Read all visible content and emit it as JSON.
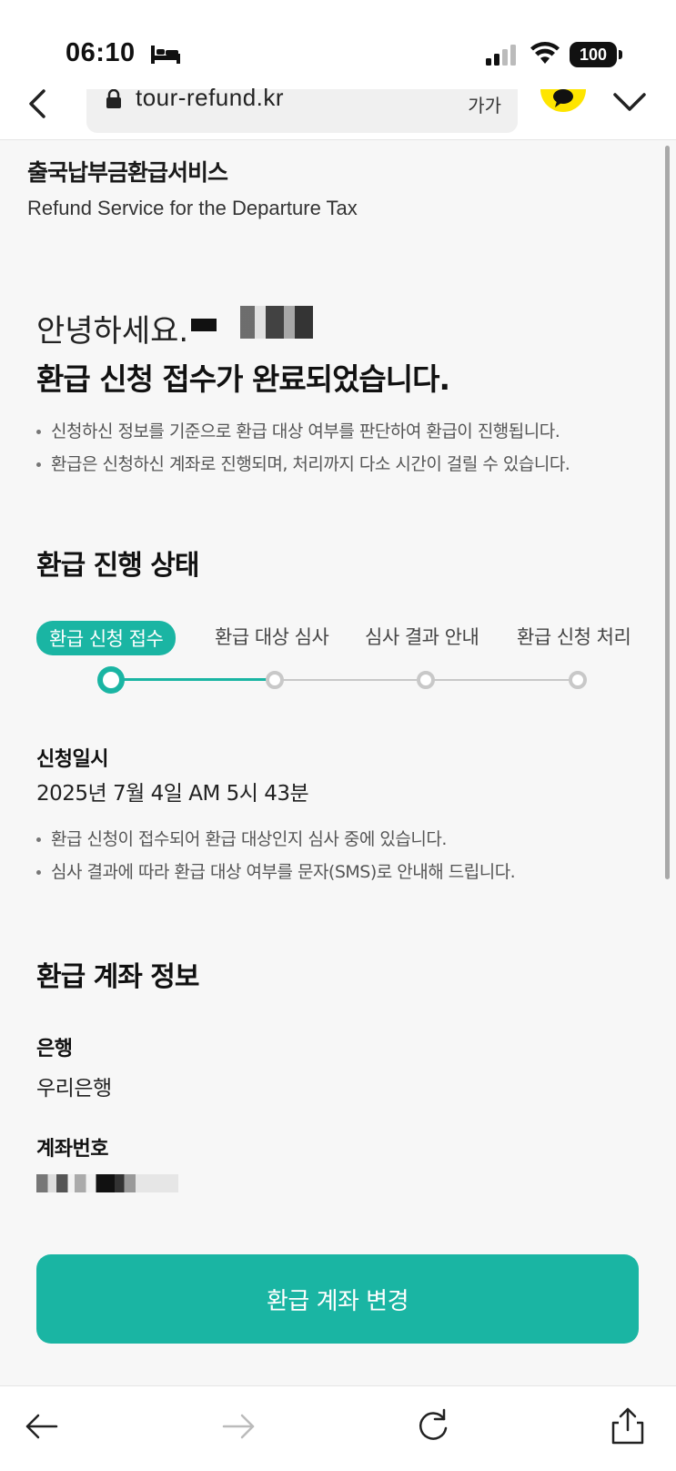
{
  "status_bar": {
    "time": "06:10",
    "battery": "100"
  },
  "browser": {
    "url": "tour-refund.kr",
    "text_size_label": "가가"
  },
  "brand": {
    "name_ko": "출국납부금환급서비스",
    "name_en": "Refund Service for the Departure Tax"
  },
  "greeting": {
    "hello": "안녕하세요.",
    "headline": "환급 신청 접수가 완료되었습니다."
  },
  "intro_notes": [
    "신청하신 정보를 기준으로 환급 대상 여부를 판단하여 환급이 진행됩니다.",
    "환급은 신청하신 계좌로 진행되며, 처리까지 다소 시간이 걸릴 수 있습니다."
  ],
  "progress": {
    "title": "환급 진행 상태",
    "steps": [
      "환급 신청 접수",
      "환급 대상 심사",
      "심사 결과 안내",
      "환급 신청 처리"
    ],
    "current_step": 1,
    "date_label": "신청일시",
    "date_value": "2025년 7월 4일 AM 5시 43분",
    "notes": [
      "환급 신청이 접수되어 환급 대상인지 심사 중에 있습니다.",
      "심사 결과에 따라 환급 대상 여부를 문자(SMS)로 안내해 드립니다."
    ]
  },
  "account": {
    "title": "환급 계좌 정보",
    "bank_label": "은행",
    "bank_value": "우리은행",
    "number_label": "계좌번호"
  },
  "buttons": {
    "change_account": "환급 계좌 변경"
  },
  "colors": {
    "accent": "#1ab5a3",
    "kakao_yellow": "#fee500"
  }
}
